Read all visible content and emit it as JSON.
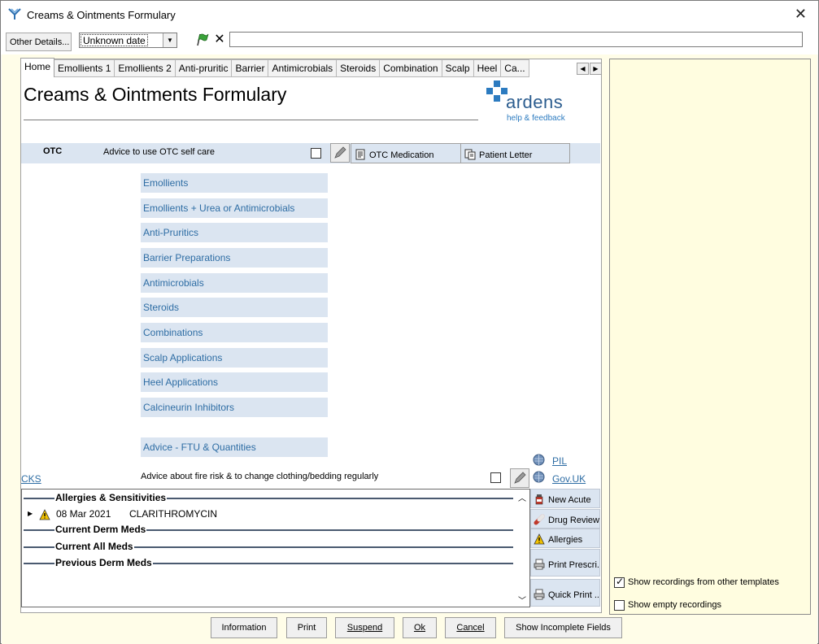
{
  "window": {
    "title": "Creams & Ointments Formulary",
    "close_glyph": "✕"
  },
  "toolbar": {
    "other_details_label": "Other Details...",
    "date_value": "Unknown date",
    "free_text_value": ""
  },
  "tabs": [
    {
      "label": "Home",
      "active": true
    },
    {
      "label": "Emollients 1"
    },
    {
      "label": "Emollients 2"
    },
    {
      "label": "Anti-pruritic"
    },
    {
      "label": "Barrier"
    },
    {
      "label": "Antimicrobials"
    },
    {
      "label": "Steroids"
    },
    {
      "label": "Combination"
    },
    {
      "label": "Scalp"
    },
    {
      "label": "Heel"
    },
    {
      "label": "Ca..."
    }
  ],
  "form": {
    "title": "Creams & Ointments Formulary",
    "logo_word": "ardens",
    "help_link": "help & feedback"
  },
  "otc": {
    "label": "OTC",
    "advice": "Advice to use OTC self care",
    "checked": false,
    "otc_medication_button": "OTC Medication",
    "patient_letter_button": "Patient Letter"
  },
  "nav_buttons": [
    "Emollients",
    "Emollients + Urea or Antimicrobials",
    "Anti-Pruritics",
    "Barrier Preparations",
    "Antimicrobials",
    "Steroids",
    "Combinations",
    "Scalp Applications",
    "Heel Applications",
    "Calcineurin Inhibitors"
  ],
  "advice_ftu": "Advice - FTU & Quantities",
  "cks_link": "CKS",
  "fire_advice": "Advice about fire risk & to change clothing/bedding regularly",
  "pil_link": "PIL",
  "govuk_link": "Gov.UK",
  "meds_panel": {
    "sections": [
      "Allergies & Sensitivities",
      "Current Derm Meds",
      "Current All Meds",
      "Previous Derm Meds"
    ],
    "allergy": {
      "date": "08 Mar 2021",
      "name": "CLARITHROMYCIN"
    }
  },
  "side_buttons": [
    "New Acute",
    "Drug Review",
    "Allergies",
    "Print Prescri...",
    "Quick Print ..."
  ],
  "right_panel": {
    "show_other_templates_label": "Show recordings from other templates",
    "show_other_templates_checked": true,
    "show_empty_label": "Show empty recordings",
    "show_empty_checked": false
  },
  "bottom_buttons": {
    "information": "Information",
    "print": "Print",
    "suspend": "Suspend",
    "ok": "Ok",
    "cancel": "Cancel",
    "show_incomplete": "Show Incomplete Fields"
  },
  "colors": {
    "accent_blue": "#2e6da4",
    "panel_blue": "#dbe5f1",
    "yellow_bg": "#fffde8"
  }
}
